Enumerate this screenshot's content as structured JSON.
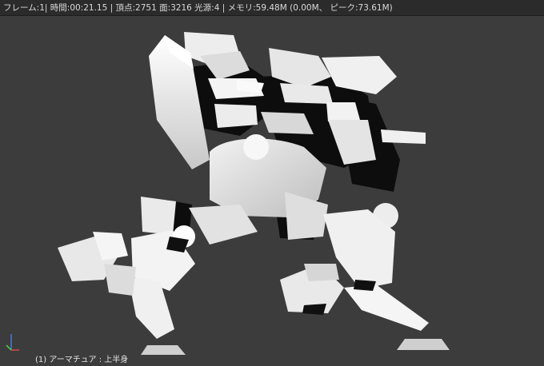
{
  "header": {
    "stats": "フレーム:1| 時間:00:21.15 | 頂点:2751 面:3216 光源:4 | メモリ:59.48M (0.00M、 ピーク:73.61M)"
  },
  "viewport": {
    "object_label": "(1) アーマチュア : 上半身",
    "background_color": "#3c3c3c"
  },
  "axis_gizmo": {
    "icon": "axis-gizmo-icon",
    "colors": {
      "x": "#d84a4a",
      "y": "#4fd84f",
      "z": "#4a7ad8"
    }
  },
  "model": {
    "icon": "robot-model"
  }
}
